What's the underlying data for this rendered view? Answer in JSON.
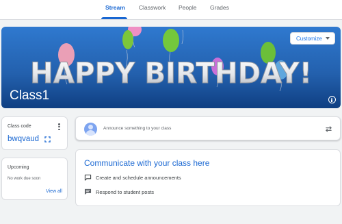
{
  "nav": {
    "tabs": [
      {
        "label": "Stream",
        "active": true
      },
      {
        "label": "Classwork",
        "active": false
      },
      {
        "label": "People",
        "active": false
      },
      {
        "label": "Grades",
        "active": false
      }
    ]
  },
  "banner": {
    "headline": "HAPPY BIRTHDAY!",
    "class_name": "Class1",
    "customize_label": "Customize",
    "info_icon": "info-icon"
  },
  "class_code": {
    "title": "Class code",
    "value": "bwqvaud"
  },
  "upcoming": {
    "title": "Upcoming",
    "empty_text": "No work due soon",
    "view_all": "View all"
  },
  "announce": {
    "placeholder": "Announce something to your class"
  },
  "communicate": {
    "title": "Communicate with your class here",
    "items": [
      {
        "label": "Create and schedule announcements",
        "icon": "announcement-icon"
      },
      {
        "label": "Respond to student posts",
        "icon": "comment-icon"
      }
    ]
  },
  "colors": {
    "accent": "#1967d2",
    "banner": "#2f79cf",
    "background": "#f1f3f4"
  }
}
